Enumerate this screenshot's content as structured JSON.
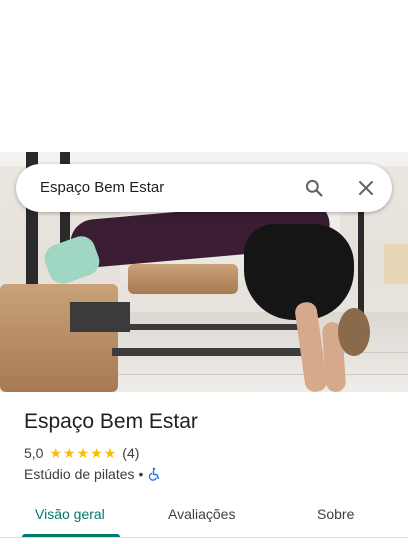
{
  "search": {
    "query": "Espaço Bem Estar"
  },
  "place": {
    "name": "Espaço Bem Estar",
    "rating": "5,0",
    "stars": [
      "★",
      "★",
      "★",
      "★",
      "★"
    ],
    "review_count": "(4)",
    "category": "Estúdio de pilates",
    "separator": "•",
    "accessibility_icon": "wheelchair-icon"
  },
  "tabs": [
    {
      "label": "Visão geral",
      "active": true
    },
    {
      "label": "Avaliações",
      "active": false
    },
    {
      "label": "Sobre",
      "active": false
    }
  ],
  "colors": {
    "accent": "#00796b",
    "star": "#fbbc04",
    "accessibility": "#1a73e8",
    "text": "#202124",
    "secondary_text": "#3c4043"
  }
}
